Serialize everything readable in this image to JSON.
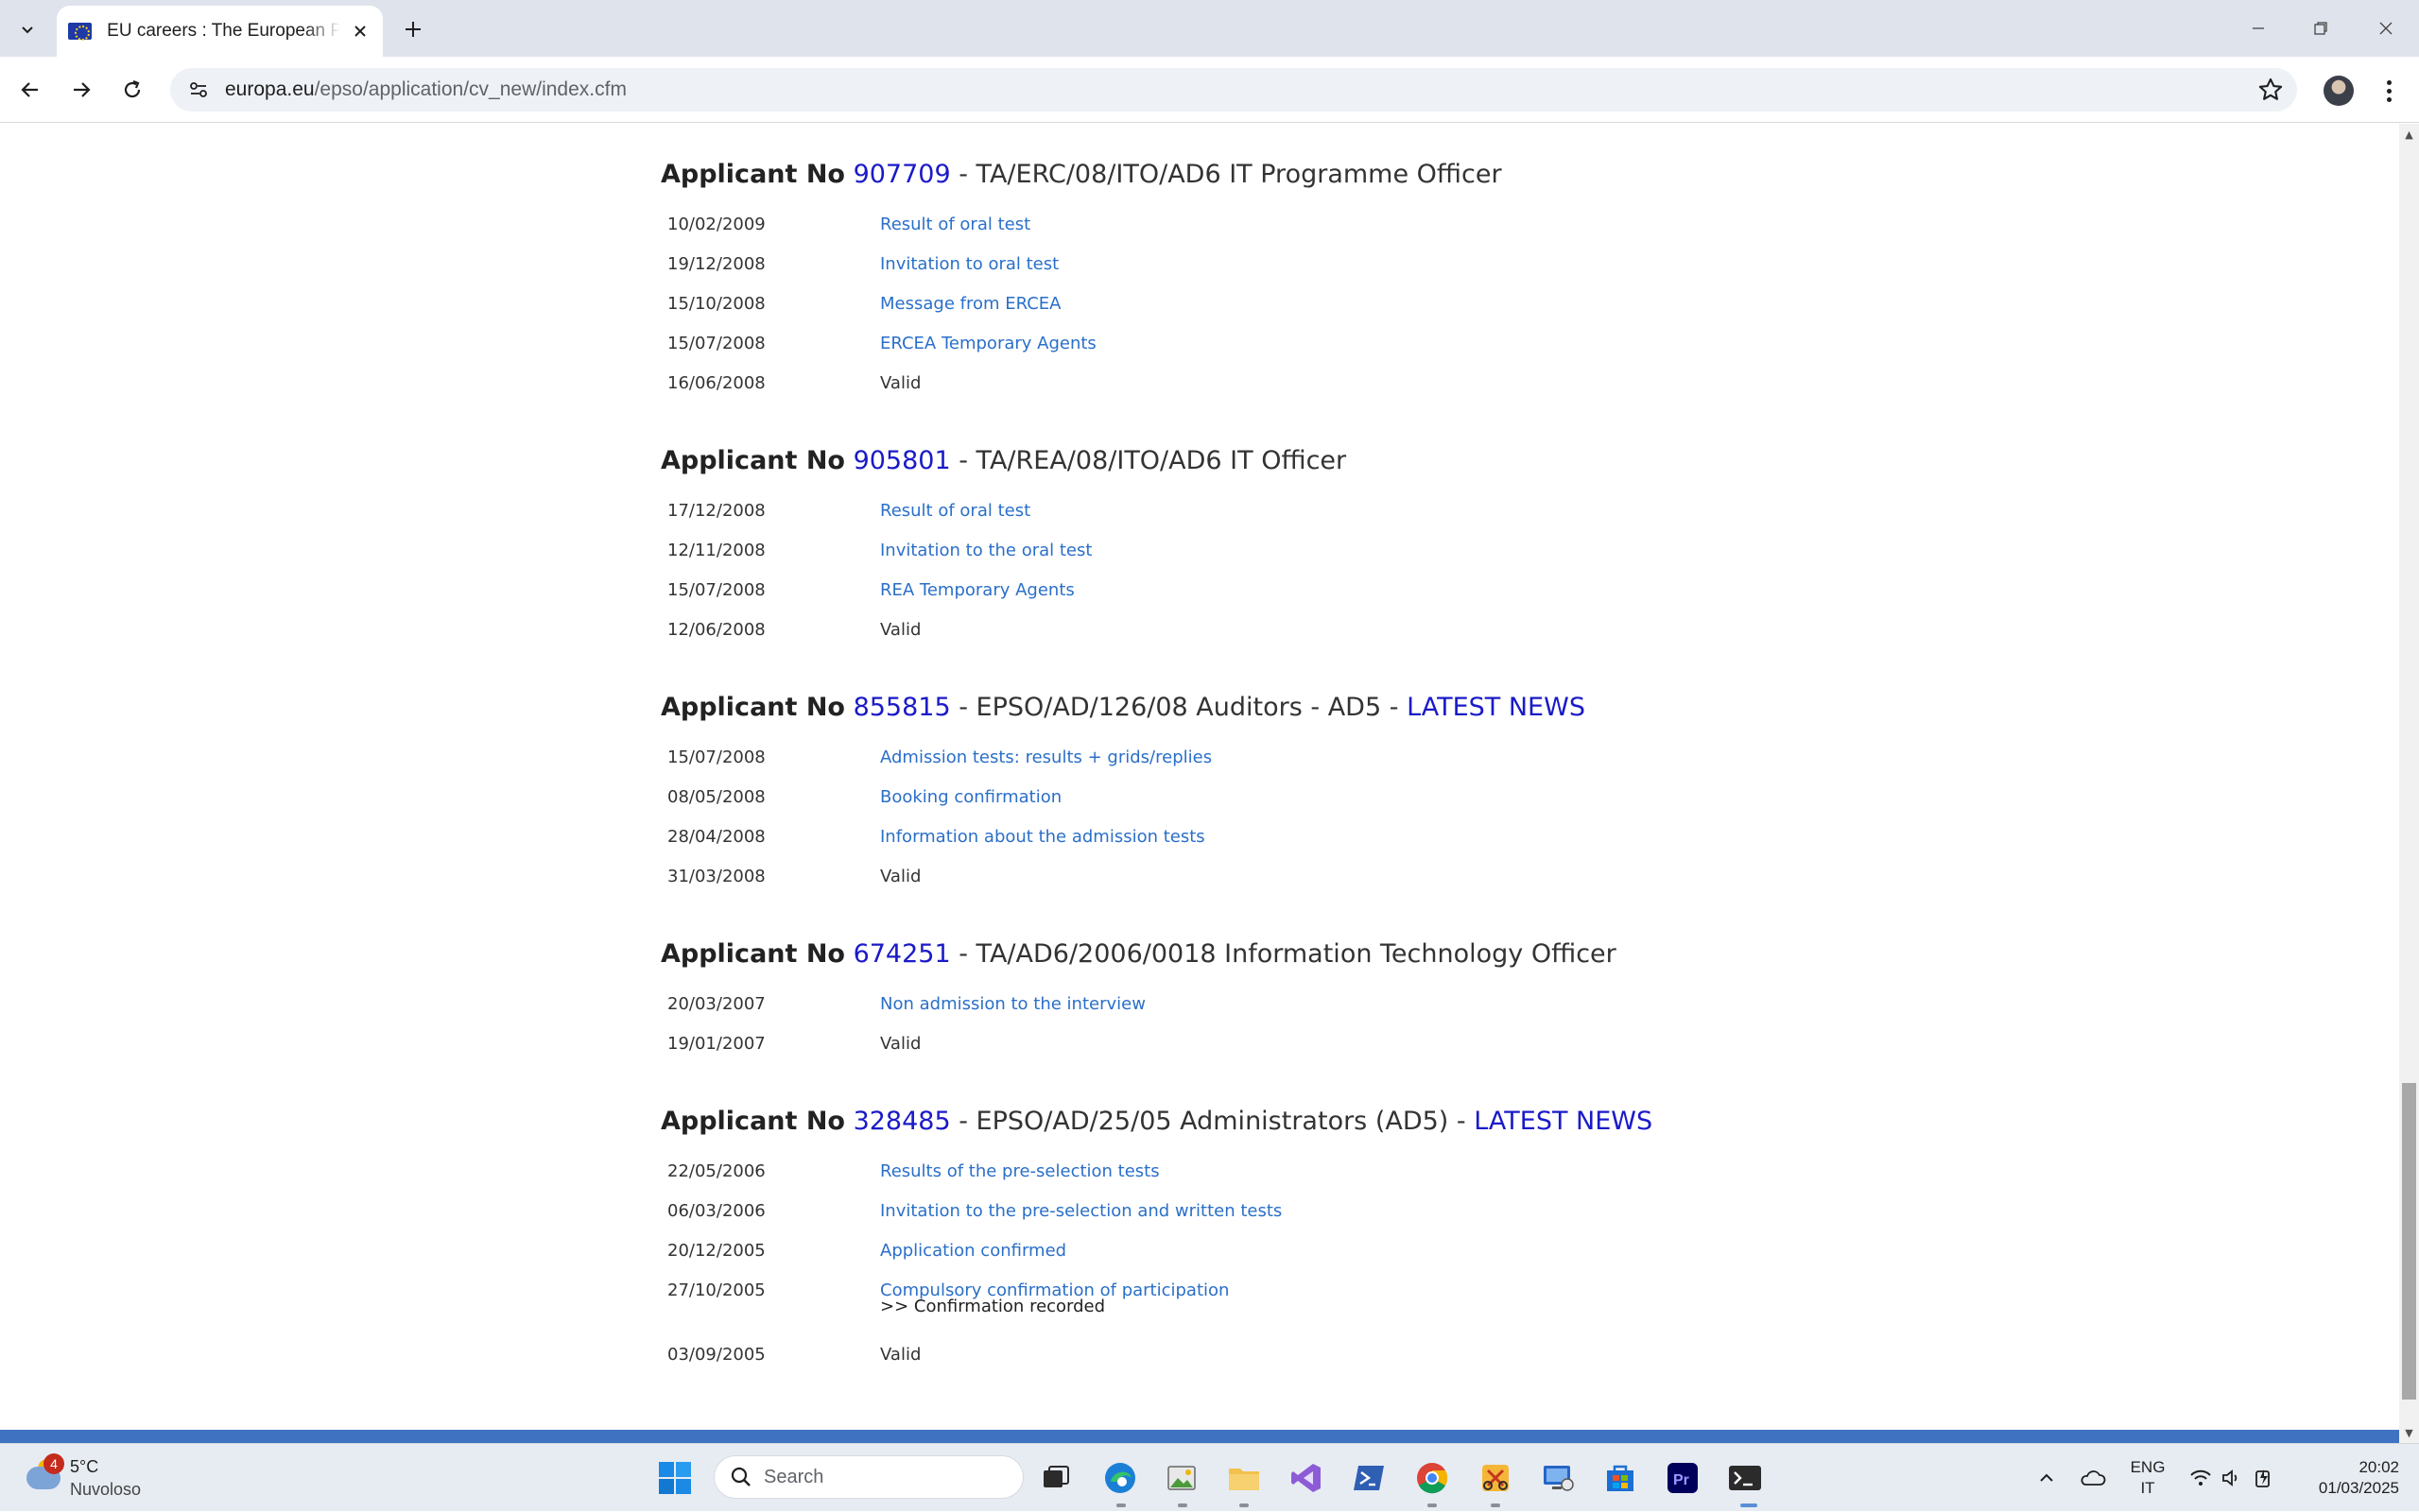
{
  "browser": {
    "tab_title": "EU careers : The European Personnel Selection Office",
    "url_host": "europa.eu",
    "url_path": "/epso/application/cv_new/index.cfm"
  },
  "applicants": [
    {
      "label": "Applicant No",
      "number": "907709",
      "title": " - TA/ERC/08/ITO/AD6 IT Programme Officer",
      "news": "",
      "entries": [
        {
          "date": "10/02/2009",
          "text": "Result of oral test",
          "link": true
        },
        {
          "date": "19/12/2008",
          "text": "Invitation to oral test",
          "link": true
        },
        {
          "date": "15/10/2008",
          "text": "Message from ERCEA",
          "link": true
        },
        {
          "date": "15/07/2008",
          "text": "ERCEA Temporary Agents",
          "link": true
        },
        {
          "date": "16/06/2008",
          "text": "Valid",
          "link": false
        }
      ]
    },
    {
      "label": "Applicant No",
      "number": "905801",
      "title": " - TA/REA/08/ITO/AD6 IT Officer",
      "news": "",
      "entries": [
        {
          "date": "17/12/2008",
          "text": "Result of oral test",
          "link": true
        },
        {
          "date": "12/11/2008",
          "text": "Invitation to the oral test",
          "link": true
        },
        {
          "date": "15/07/2008",
          "text": "REA Temporary Agents",
          "link": true
        },
        {
          "date": "12/06/2008",
          "text": "Valid",
          "link": false
        }
      ]
    },
    {
      "label": "Applicant No",
      "number": "855815",
      "title": " - EPSO/AD/126/08 Auditors - AD5 - ",
      "news": "LATEST NEWS",
      "entries": [
        {
          "date": "15/07/2008",
          "text": "Admission tests: results + grids/replies",
          "link": true
        },
        {
          "date": "08/05/2008",
          "text": "Booking confirmation",
          "link": true
        },
        {
          "date": "28/04/2008",
          "text": "Information about the admission tests",
          "link": true
        },
        {
          "date": "31/03/2008",
          "text": "Valid",
          "link": false
        }
      ]
    },
    {
      "label": "Applicant No",
      "number": "674251",
      "title": " - TA/AD6/2006/0018 Information Technology Officer",
      "news": "",
      "entries": [
        {
          "date": "20/03/2007",
          "text": "Non admission to the interview",
          "link": true
        },
        {
          "date": "19/01/2007",
          "text": "Valid",
          "link": false
        }
      ]
    },
    {
      "label": "Applicant No",
      "number": "328485",
      "title": " - EPSO/AD/25/05 Administrators (AD5) - ",
      "news": "LATEST NEWS",
      "entries": [
        {
          "date": "22/05/2006",
          "text": "Results of the pre-selection tests",
          "link": true
        },
        {
          "date": "06/03/2006",
          "text": "Invitation to the pre-selection and written tests",
          "link": true
        },
        {
          "date": "20/12/2005",
          "text": "Application confirmed",
          "link": true
        },
        {
          "date": "27/10/2005",
          "text": "Compulsory confirmation of participation",
          "link": true,
          "sub": ">> Confirmation recorded"
        },
        {
          "date": "03/09/2005",
          "text": "Valid",
          "link": false
        }
      ]
    }
  ],
  "taskbar": {
    "weather_badge": "4",
    "weather_temp": "5°C",
    "weather_cond": "Nuvoloso",
    "search_label": "Search",
    "lang_line1": "ENG",
    "lang_line2": "IT",
    "time": "20:02",
    "date": "01/03/2025"
  },
  "colors": {
    "link": "#2a6fc9",
    "applicant_number": "#1a1ac8",
    "footer_bar": "#3f73c2"
  }
}
